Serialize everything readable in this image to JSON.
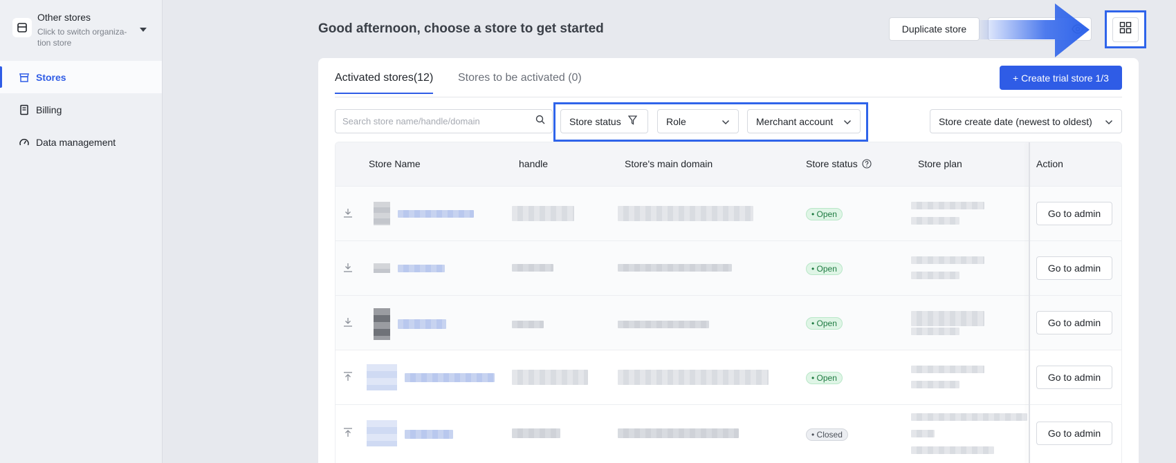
{
  "sidebar": {
    "org": {
      "title": "Other stores",
      "subtitle": "Click to switch organiza-tion store"
    },
    "items": [
      {
        "label": "Stores",
        "icon": "store-icon",
        "active": true
      },
      {
        "label": "Billing",
        "icon": "billing-icon",
        "active": false
      },
      {
        "label": "Data management",
        "icon": "gauge-icon",
        "active": false
      }
    ]
  },
  "header": {
    "greeting": "Good afternoon, choose a store to get started",
    "duplicate_label": "Duplicate store"
  },
  "tabs": {
    "activated": "Activated stores(12)",
    "to_activate": "Stores to be activated (0)"
  },
  "create_button": "+ Create trial store 1/3",
  "filters": {
    "search_placeholder": "Search store name/handle/domain",
    "status": "Store status",
    "role": "Role",
    "merchant": "Merchant account",
    "sort": "Store create date (newest to oldest)"
  },
  "table": {
    "columns": {
      "name": "Store Name",
      "handle": "handle",
      "domain": "Store's main domain",
      "status": "Store status",
      "plan": "Store plan",
      "action": "Action"
    },
    "rows": [
      {
        "status": "Open",
        "status_type": "open",
        "action": "Go to admin",
        "icon": "download-icon"
      },
      {
        "status": "Open",
        "status_type": "open",
        "action": "Go to admin",
        "icon": "download-icon"
      },
      {
        "status": "Open",
        "status_type": "open",
        "action": "Go to admin",
        "icon": "download-icon"
      },
      {
        "status": "Open",
        "status_type": "open",
        "action": "Go to admin",
        "icon": "upload-icon"
      },
      {
        "status": "Closed",
        "status_type": "closed",
        "action": "Go to admin",
        "icon": "upload-icon"
      }
    ]
  },
  "colors": {
    "accent": "#2f5ce6",
    "highlight": "#2f64ea"
  }
}
